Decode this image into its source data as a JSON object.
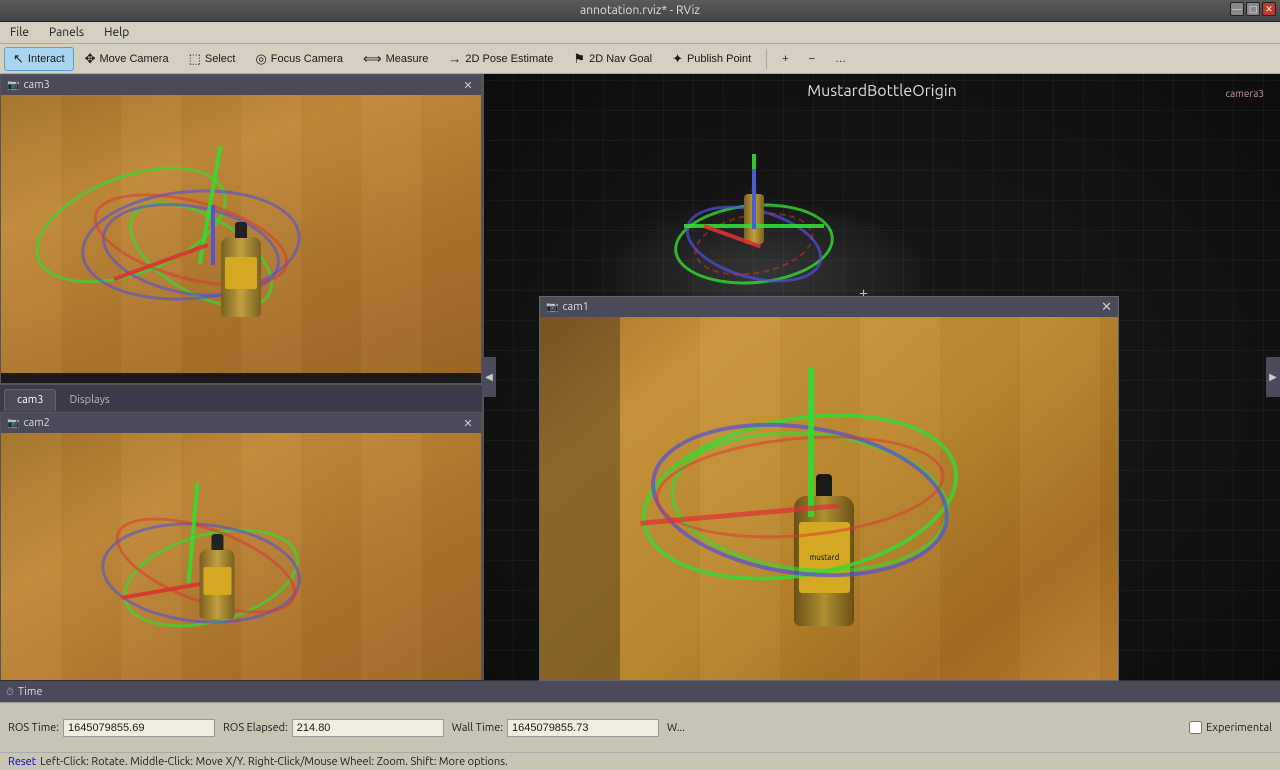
{
  "window": {
    "title": "annotation.rviz* - RViz",
    "controls": [
      "minimize",
      "maximize",
      "close"
    ]
  },
  "menubar": {
    "items": [
      "File",
      "Panels",
      "Help"
    ]
  },
  "toolbar": {
    "buttons": [
      {
        "id": "interact",
        "label": "Interact",
        "icon": "cursor",
        "active": true
      },
      {
        "id": "move-camera",
        "label": "Move Camera",
        "icon": "move",
        "active": false
      },
      {
        "id": "select",
        "label": "Select",
        "icon": "select",
        "active": false
      },
      {
        "id": "focus-camera",
        "label": "Focus Camera",
        "icon": "focus",
        "active": false
      },
      {
        "id": "measure",
        "label": "Measure",
        "icon": "ruler",
        "active": false
      },
      {
        "id": "2d-pose-estimate",
        "label": "2D Pose Estimate",
        "icon": "pose",
        "active": false
      },
      {
        "id": "2d-nav-goal",
        "label": "2D Nav Goal",
        "icon": "nav",
        "active": false
      },
      {
        "id": "publish-point",
        "label": "Publish Point",
        "icon": "point",
        "active": false
      }
    ],
    "extras": [
      "+",
      "-",
      "..."
    ]
  },
  "panels": {
    "cam3": {
      "label": "cam3",
      "icon": "camera"
    },
    "cam2": {
      "label": "cam2",
      "icon": "camera"
    },
    "cam1": {
      "label": "cam1",
      "icon": "camera"
    },
    "tabs": [
      "cam3",
      "Displays"
    ]
  },
  "view3d": {
    "label": "MustardBottleOrigin",
    "camera_label": "camera3"
  },
  "timebar": {
    "ros_time_label": "ROS Time:",
    "ros_time_value": "1645079855.69",
    "ros_elapsed_label": "ROS Elapsed:",
    "ros_elapsed_value": "214.80",
    "wall_time_label": "Wall Time:",
    "wall_time_value": "1645079855.73",
    "wall_extra": "W...",
    "time_icon": "clock",
    "time_panel_label": "Time",
    "experimental_checkbox": false,
    "experimental_label": "Experimental"
  },
  "footer": {
    "reset_label": "Reset",
    "hint": "Left-Click: Rotate.  Middle-Click: Move X/Y.  Right-Click/Mouse Wheel: Zoom.  Shift: More options."
  },
  "statusbar": {
    "icon": "clock",
    "label": "Time"
  }
}
